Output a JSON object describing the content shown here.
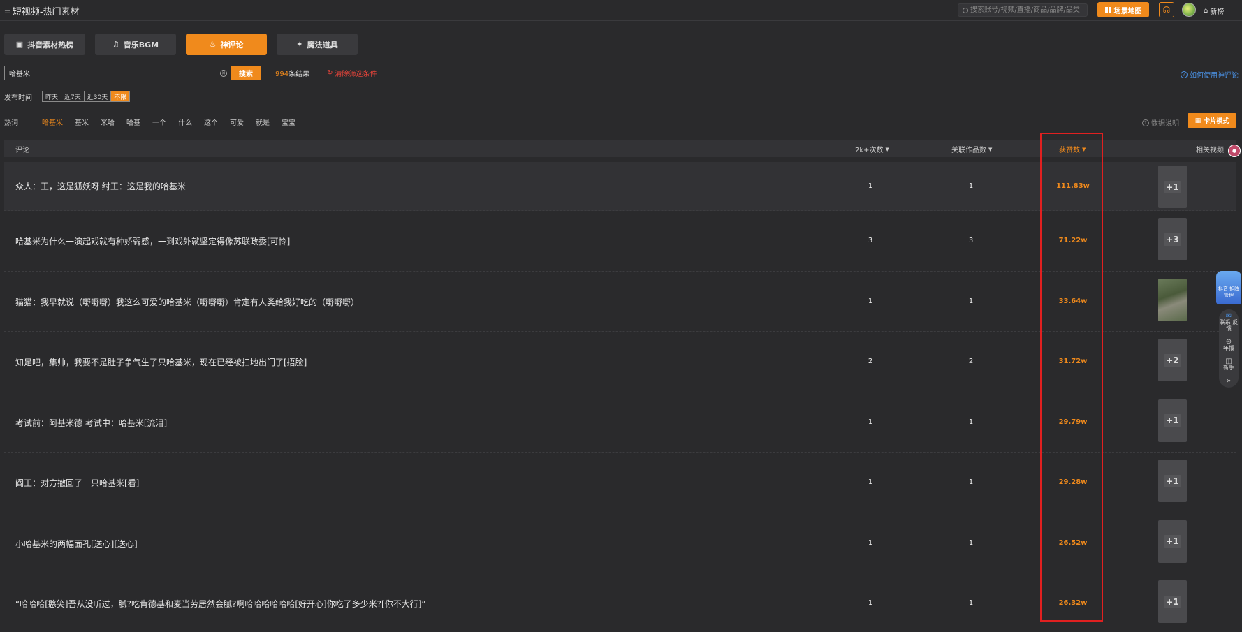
{
  "app": {
    "title": "短视频-热门素材"
  },
  "header": {
    "search_placeholder": "搜索账号/视频/直播/商品/品牌/品类",
    "map_button": "场景地图",
    "new_label": "新榜"
  },
  "tabs": [
    {
      "label": "抖音素材热榜",
      "icon": "box-icon"
    },
    {
      "label": "音乐BGM",
      "icon": "music-icon"
    },
    {
      "label": "神评论",
      "icon": "fire-icon"
    },
    {
      "label": "魔法道具",
      "icon": "magic-wand-icon"
    }
  ],
  "search": {
    "value": "哈基米",
    "button": "搜索",
    "result_num": "994",
    "result_suffix": "条结果",
    "clear_filter": "清除筛选条件",
    "howto": "如何使用神评论"
  },
  "time_filter": {
    "label": "发布时间",
    "options": [
      "昨天",
      "近7天",
      "近30天",
      "不限"
    ],
    "selected": "不限"
  },
  "hot_words": {
    "label": "热词",
    "items": [
      "哈基米",
      "基米",
      "米哈",
      "哈基",
      "一个",
      "什么",
      "这个",
      "可爱",
      "就是",
      "宝宝"
    ],
    "selected": "哈基米"
  },
  "toolbar": {
    "data_note": "数据说明",
    "card_mode": "卡片模式"
  },
  "table": {
    "headers": {
      "comment": "评论",
      "count": "2k+次数",
      "works": "关联作品数",
      "likes": "获赞数",
      "related": "相关视频"
    },
    "rows": [
      {
        "comment": "众人：王，这是狐妖呀 纣王：这是我的哈基米",
        "count": "1",
        "works": "1",
        "likes": "111.83w",
        "thumb": "+1"
      },
      {
        "comment": "哈基米为什么一演起戏就有种娇弱感，一到戏外就坚定得像苏联政委[可怜]",
        "count": "3",
        "works": "3",
        "likes": "71.22w",
        "thumb": "+3"
      },
      {
        "comment": "猫猫：我早就说（嘢嘢嘢）我这么可爱的哈基米（嘢嘢嘢）肯定有人类给我好吃的（嘢嘢嘢）",
        "count": "1",
        "works": "1",
        "likes": "33.64w",
        "thumb": ""
      },
      {
        "comment": "知足吧，集帅，我要不是肚子争气生了只哈基米，现在已经被扫地出门了[捂脸]",
        "count": "2",
        "works": "2",
        "likes": "31.72w",
        "thumb": "+2"
      },
      {
        "comment": "考试前：阿基米德 考试中：哈基米[流泪]",
        "count": "1",
        "works": "1",
        "likes": "29.79w",
        "thumb": "+1"
      },
      {
        "comment": "阎王：对方撤回了一只哈基米[看]",
        "count": "1",
        "works": "1",
        "likes": "29.28w",
        "thumb": "+1"
      },
      {
        "comment": "小哈基米的两幅面孔[送心][送心]",
        "count": "1",
        "works": "1",
        "likes": "26.52w",
        "thumb": "+1"
      },
      {
        "comment": "“哈哈哈[憨笑]吾从没听过，膩?吃肯德基和麦当劳居然会膩?啊哈哈哈哈哈哈[好开心]你吃了多少米?[你不大行]”",
        "count": "1",
        "works": "1",
        "likes": "26.32w",
        "thumb": "+1"
      }
    ]
  },
  "sidebar_float": {
    "douyin": "抖音 矩阵管理",
    "items": [
      "联系 反馈",
      "年报",
      "新手"
    ]
  }
}
